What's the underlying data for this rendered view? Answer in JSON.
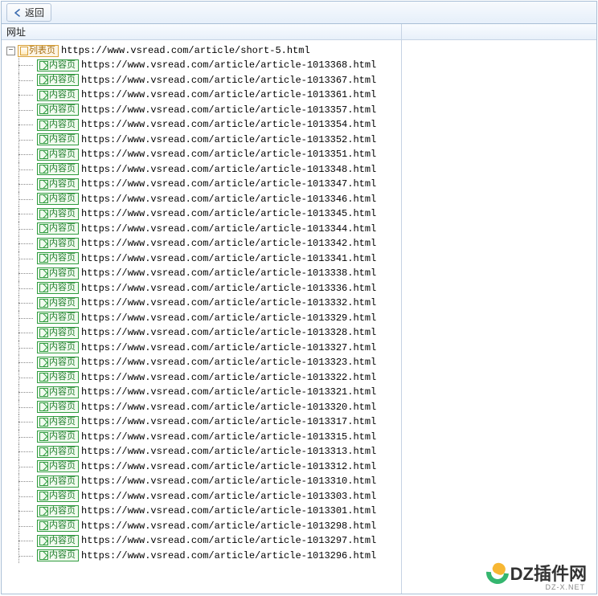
{
  "toolbar": {
    "back_label": "返回"
  },
  "columns": {
    "left_header": "网址"
  },
  "root": {
    "expander": "−",
    "tag_label": "列表页",
    "url": "https://www.vsread.com/article/short-5.html"
  },
  "child_tag_label": "内容页",
  "url_prefix": "https://www.vsread.com/article/article-",
  "url_suffix": ".html",
  "child_ids": [
    "1013368",
    "1013367",
    "1013361",
    "1013357",
    "1013354",
    "1013352",
    "1013351",
    "1013348",
    "1013347",
    "1013346",
    "1013345",
    "1013344",
    "1013342",
    "1013341",
    "1013338",
    "1013336",
    "1013332",
    "1013329",
    "1013328",
    "1013327",
    "1013323",
    "1013322",
    "1013321",
    "1013320",
    "1013317",
    "1013315",
    "1013313",
    "1013312",
    "1013310",
    "1013303",
    "1013301",
    "1013298",
    "1013297",
    "1013296"
  ],
  "watermark": {
    "text": "DZ插件网",
    "sub": "DZ-X.NET"
  }
}
